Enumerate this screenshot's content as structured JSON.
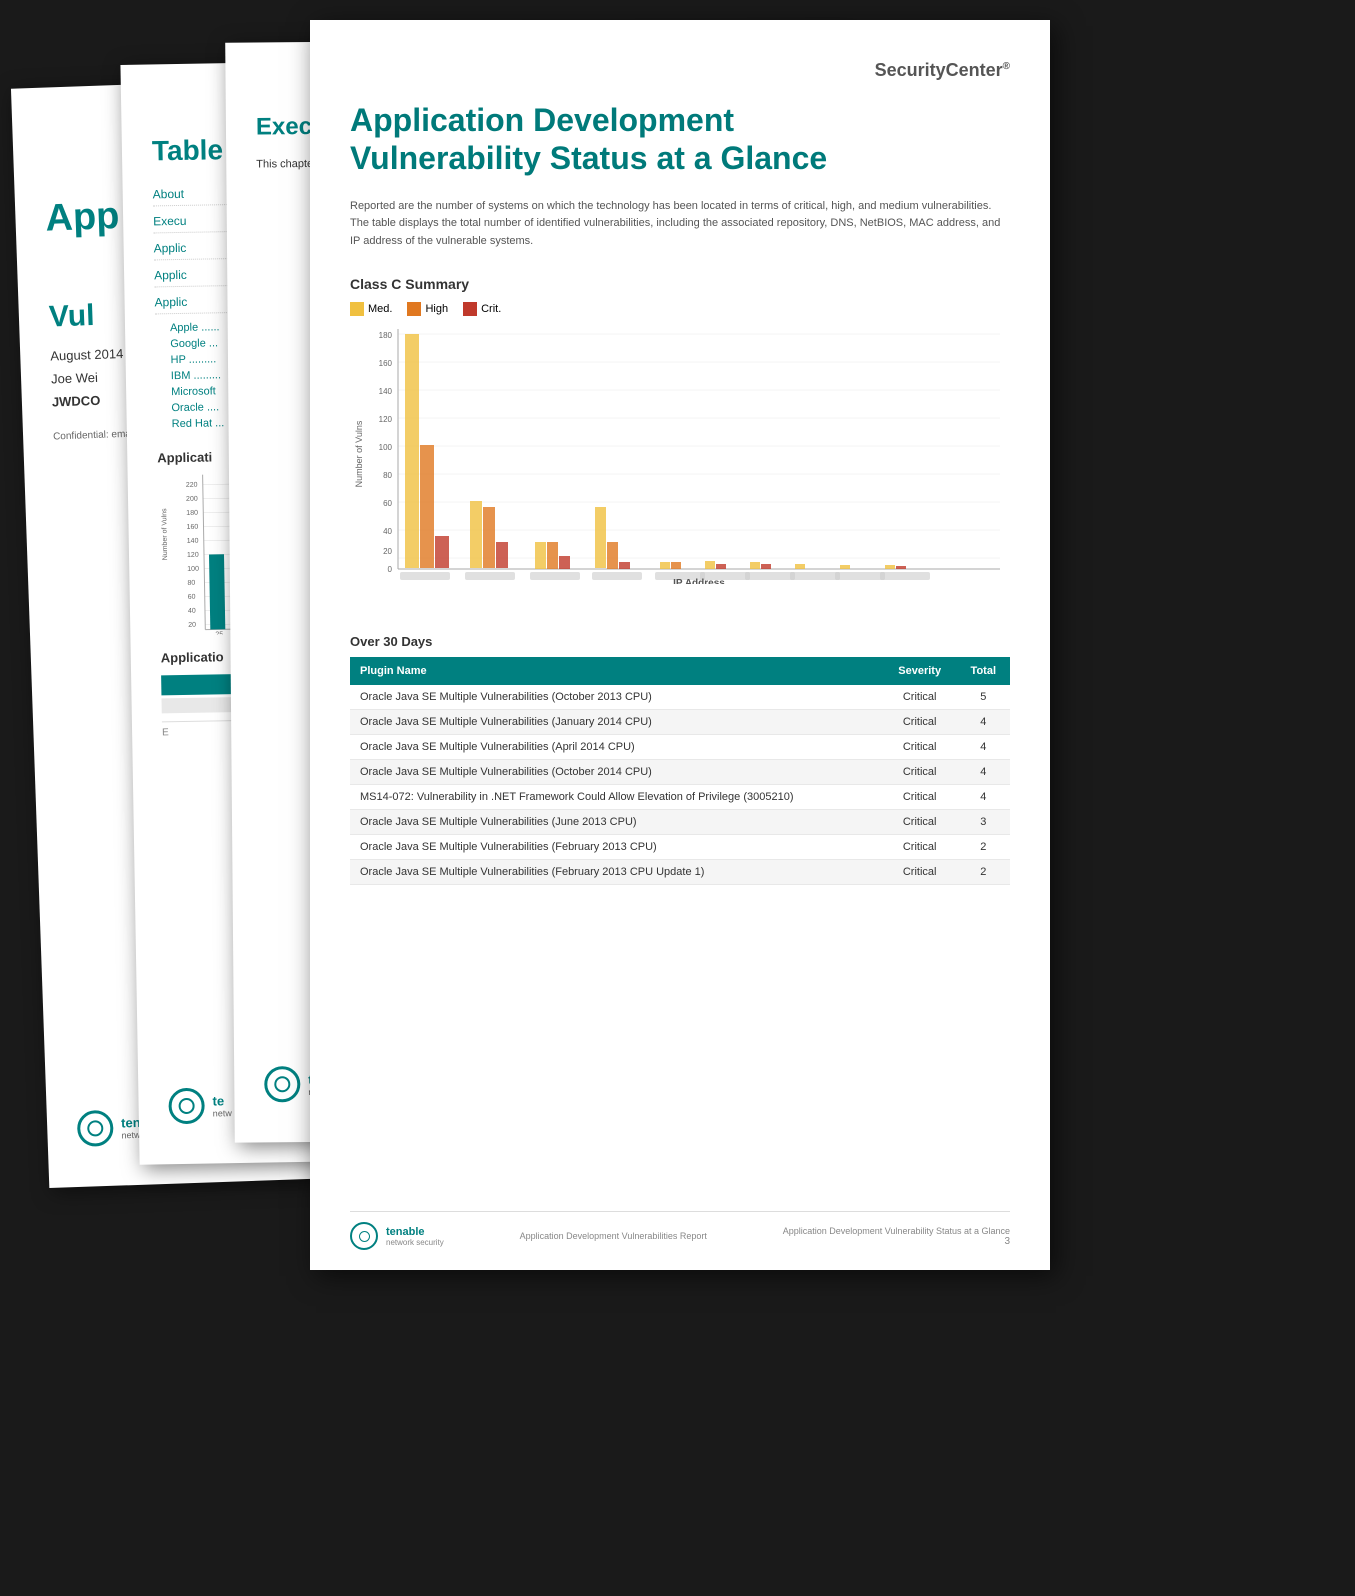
{
  "pages": {
    "cover": {
      "logo": "SecurityCenter",
      "logo_tm": "®",
      "title_line1": "App",
      "title_line2": "Vul",
      "full_title_line1": "Application Development",
      "full_title_line2": "Vulnerabilities",
      "date": "August 2014",
      "author_name": "Joe Wei",
      "author_company": "JWDCO",
      "confidential_text": "Confidential: email, fax, or recipient cor saved on pr within this re any of the pr",
      "tenable_name": "ten",
      "tenable_sub": "networ"
    },
    "toc": {
      "logo": "SecurityCenter",
      "logo_tm": "®",
      "title": "Table of Contents",
      "items": [
        {
          "label": "About"
        },
        {
          "label": "Execu"
        },
        {
          "label": "Applic"
        },
        {
          "label": "Applic"
        },
        {
          "label": "Applic"
        }
      ],
      "sub_items": [
        {
          "label": "Apple ......"
        },
        {
          "label": "Google ..."
        },
        {
          "label": "HP ........."
        },
        {
          "label": "IBM ........."
        },
        {
          "label": "Microsoft"
        },
        {
          "label": "Oracle ...."
        },
        {
          "label": "Red Hat ..."
        }
      ],
      "chart_title": "Applicati",
      "y_axis_values": [
        "220",
        "200",
        "180",
        "160",
        "140",
        "120",
        "100",
        "80",
        "60",
        "40",
        "20",
        "0"
      ],
      "x_label": "25",
      "chart_title2": "Applicatio",
      "tenable_name": "te",
      "tenable_sub": "netw"
    },
    "exec": {
      "logo": "SecurityCenter",
      "logo_tm": "®",
      "title": "Executive Summary",
      "text": "This chapter additional ma patching and",
      "tenable_name": "te",
      "tenable_sub": "netw"
    },
    "main": {
      "logo": "SecurityCenter",
      "logo_tm": "®",
      "title_line1": "Application Development",
      "title_line2": "Vulnerability Status at a Glance",
      "description": "Reported are the number of systems on which the technology has been located in terms of critical, high, and medium vulnerabilities. The table displays the total number of identified vulnerabilities, including the associated repository, DNS, NetBIOS, MAC address, and IP address of the vulnerable systems.",
      "chart_title": "Class C Summary",
      "chart_legend": {
        "med_label": "Med.",
        "high_label": "High",
        "crit_label": "Crit."
      },
      "y_axis_label": "Number of Vulns",
      "x_axis_label": "IP Address",
      "y_values": [
        "180",
        "160",
        "140",
        "120",
        "100",
        "80",
        "60",
        "40",
        "20",
        "0"
      ],
      "table_section_title": "Over 30 Days",
      "table_headers": [
        "Plugin Name",
        "Severity",
        "Total"
      ],
      "table_rows": [
        {
          "plugin": "Oracle Java SE Multiple Vulnerabilities (October 2013 CPU)",
          "severity": "Critical",
          "total": "5"
        },
        {
          "plugin": "Oracle Java SE Multiple Vulnerabilities (January 2014 CPU)",
          "severity": "Critical",
          "total": "4"
        },
        {
          "plugin": "Oracle Java SE Multiple Vulnerabilities (April 2014 CPU)",
          "severity": "Critical",
          "total": "4"
        },
        {
          "plugin": "Oracle Java SE Multiple Vulnerabilities (October 2014 CPU)",
          "severity": "Critical",
          "total": "4"
        },
        {
          "plugin": "MS14-072: Vulnerability in .NET Framework Could Allow Elevation of Privilege (3005210)",
          "severity": "Critical",
          "total": "4"
        },
        {
          "plugin": "Oracle Java SE Multiple Vulnerabilities (June 2013 CPU)",
          "severity": "Critical",
          "total": "3"
        },
        {
          "plugin": "Oracle Java SE Multiple Vulnerabilities (February 2013 CPU)",
          "severity": "Critical",
          "total": "2"
        },
        {
          "plugin": "Oracle Java SE Multiple Vulnerabilities (February 2013 CPU Update 1)",
          "severity": "Critical",
          "total": "2"
        }
      ],
      "footer_report_name": "Application Development Vulnerabilities Report",
      "footer_page_desc": "Application Development Vulnerability Status at a Glance",
      "footer_page_num": "3",
      "tenable_name": "tenable",
      "tenable_sub": "network security"
    }
  },
  "colors": {
    "teal": "#008080",
    "med": "#f0c040",
    "high": "#e07820",
    "crit": "#c0392b",
    "light_teal": "#00a0a0"
  }
}
